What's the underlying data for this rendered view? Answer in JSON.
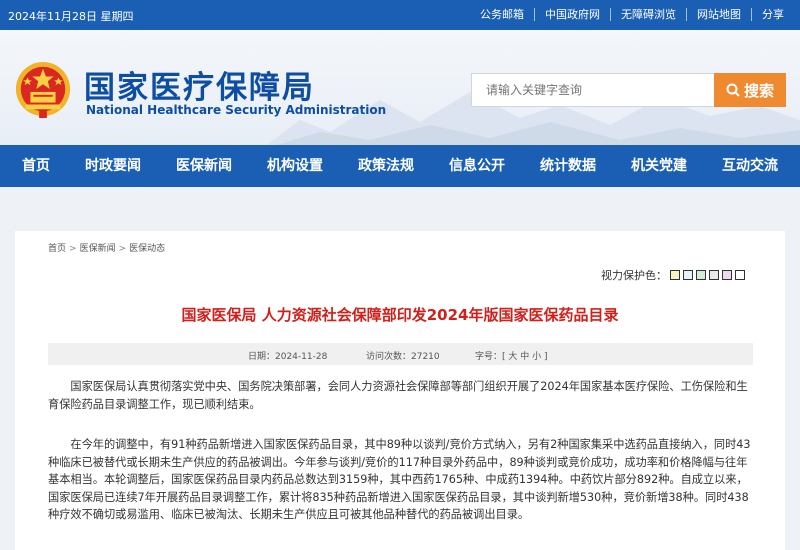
{
  "topbar": {
    "date": "2024年11月28日 星期四",
    "links": [
      "公务邮箱",
      "中国政府网",
      "无障碍浏览",
      "网站地图",
      "分享"
    ]
  },
  "header": {
    "title_cn": "国家医疗保障局",
    "title_en": "National Healthcare Security Administration",
    "search_placeholder": "请输入关键字查询",
    "search_button": "搜索"
  },
  "nav": [
    "首页",
    "时政要闻",
    "医保新闻",
    "机构设置",
    "政策法规",
    "信息公开",
    "统计数据",
    "机关党建",
    "互动交流"
  ],
  "breadcrumb": [
    "首页",
    "医保新闻",
    "医保动态"
  ],
  "vision": {
    "label": "视力保护色：",
    "colors": [
      "#f7f3c5",
      "#e6f2f9",
      "#d4ecd6",
      "#e9e9e9",
      "#efd9ef",
      "#ffffff"
    ]
  },
  "article": {
    "title": "国家医保局 人力资源社会保障部印发2024年版国家医保药品目录",
    "date": "日期：2024-11-28",
    "views": "访问次数：27210",
    "font_size": "字号：[ 大 中 小 ]",
    "para1": "国家医保局认真贯彻落实党中央、国务院决策部署，会同人力资源社会保障部等部门组织开展了2024年国家基本医疗保险、工伤保险和生育保险药品目录调整工作，现已顺利结束。",
    "para2": "在今年的调整中，有91种药品新增进入国家医保药品目录，其中89种以谈判/竞价方式纳入，另有2种国家集采中选药品直接纳入，同时43种临床已被替代或长期未生产供应的药品被调出。今年参与谈判/竞价的117种目录外药品中，89种谈判或竞价成功，成功率和价格降幅与往年基本相当。本轮调整后，国家医保药品目录内药品总数达到3159种，其中西药1765种、中成药1394种。中药饮片部分892种。自成立以来，国家医保局已连续7年开展药品目录调整工作，累计将835种药品新增进入国家医保药品目录，其中谈判新增530种，竞价新增38种。同时438种疗效不确切或易滥用、临床已被淘汰、长期未生产供应且可被其他品种替代的药品被调出目录。"
  }
}
